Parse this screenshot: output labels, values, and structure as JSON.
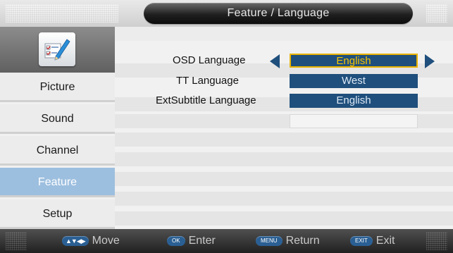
{
  "header": {
    "title": "Feature / Language"
  },
  "sidebar": {
    "icon": "settings-form-pen-icon",
    "items": [
      {
        "label": "Picture",
        "active": false
      },
      {
        "label": "Sound",
        "active": false
      },
      {
        "label": "Channel",
        "active": false
      },
      {
        "label": "Feature",
        "active": true
      },
      {
        "label": "Setup",
        "active": false
      }
    ]
  },
  "main": {
    "options": [
      {
        "label": "OSD Language",
        "value": "English",
        "selected": true
      },
      {
        "label": "TT Language",
        "value": "West",
        "selected": false
      },
      {
        "label": "ExtSubtitle Language",
        "value": "English",
        "selected": false
      }
    ]
  },
  "footer": {
    "hints": [
      {
        "key": "▲▼◀▶",
        "label": "Move"
      },
      {
        "key": "OK",
        "label": "Enter"
      },
      {
        "key": "MENU",
        "label": "Return"
      },
      {
        "key": "EXIT",
        "label": "Exit"
      }
    ]
  },
  "colors": {
    "selected_value_text": "#f7c400",
    "value_box": "#1f4f7c",
    "active_sidebar": "#9dbfdf",
    "key_badge": "#2a5f93"
  }
}
